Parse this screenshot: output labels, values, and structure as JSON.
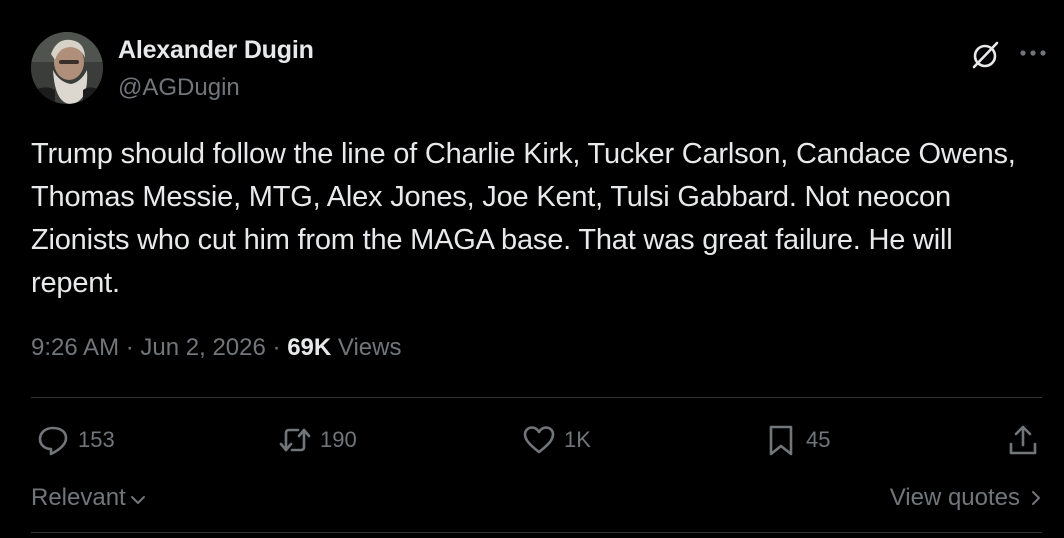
{
  "author": {
    "display_name": "Alexander Dugin",
    "handle": "@AGDugin",
    "avatar_icon": "profile-photo"
  },
  "header_icons": {
    "grok": "grok-icon",
    "more": "more-icon"
  },
  "tweet": {
    "text": "Trump should follow the line of Charlie Kirk, Tucker Carlson, Candace Owens, Thomas Messie, MTG, Alex Jones, Joe Kent, Tulsi Gabbard. Not neocon Zionists who cut him from the MAGA base. That was great failure. He will repent.",
    "time": "9:26 AM",
    "date": "Jun 2, 2026",
    "separator": "·",
    "views_count": "69K",
    "views_label": "Views"
  },
  "actions": {
    "replies": "153",
    "reposts": "190",
    "likes": "1K",
    "bookmarks": "45"
  },
  "footer": {
    "sort_label": "Relevant",
    "view_quotes_label": "View quotes"
  },
  "colors": {
    "background": "#000000",
    "primary_text": "#e7e9ea",
    "secondary_text": "#71767b",
    "divider": "#2f3336"
  }
}
